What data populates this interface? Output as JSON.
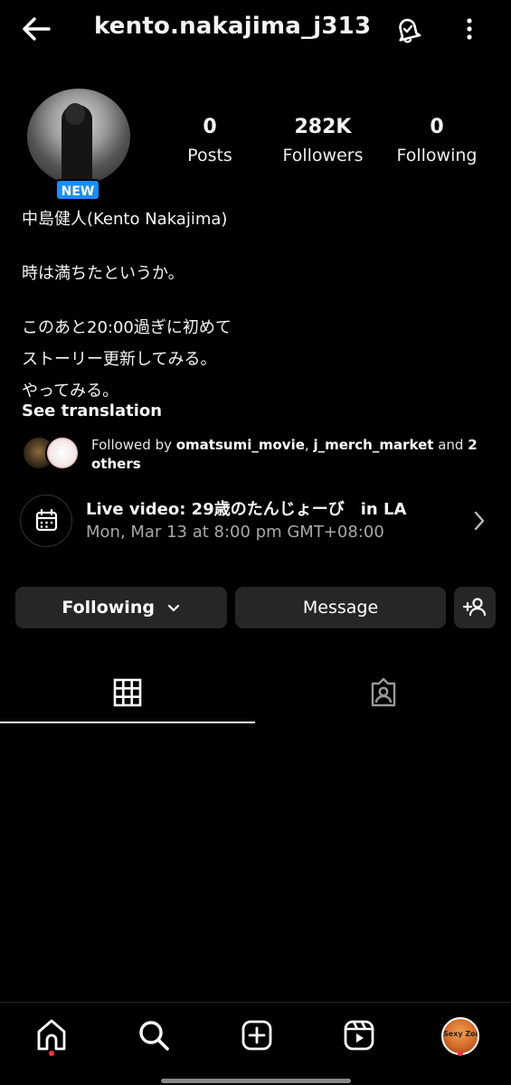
{
  "header": {
    "username": "kento.nakajima_j313",
    "icons": {
      "back": "arrow-left-icon",
      "notifications": "bell-check-icon",
      "more": "more-vertical-icon"
    }
  },
  "profile": {
    "badge": "NEW",
    "stats": [
      {
        "value": "0",
        "label": "Posts"
      },
      {
        "value": "282K",
        "label": "Followers"
      },
      {
        "value": "0",
        "label": "Following"
      }
    ],
    "bio_name": "中島健人(Kento Nakajima)",
    "bio_lines": [
      "時は満ちたというか。",
      "このあと20:00過ぎに初めて",
      "ストーリー更新してみる。",
      "やってみる。"
    ],
    "see_translation": "See translation",
    "followed_by": {
      "prefix": "Followed by ",
      "user1": "omatsumi_movie",
      "separator": ", ",
      "user2": "j_merch_market",
      "middle": " and ",
      "others": "2 others"
    }
  },
  "event": {
    "title": "Live video: 29歳のたんじょーび　in  LA",
    "datetime": "Mon, Mar 13 at 8:00 pm GMT+08:00",
    "icon": "calendar-icon"
  },
  "actions": {
    "following_label": "Following",
    "message_label": "Message"
  },
  "tabs": {
    "active": "grid",
    "items": [
      "grid-icon",
      "tagged-icon"
    ]
  },
  "bottom_nav": {
    "items": [
      "home-icon",
      "search-icon",
      "create-icon",
      "reels-icon",
      "profile-avatar"
    ],
    "profile_avatar_text": "Sexy Zone"
  },
  "colors": {
    "background": "#000000",
    "button": "#262626",
    "badge": "#1a8cff",
    "notification_dot": "#ff3040",
    "secondary_text": "#a8a8a8"
  }
}
